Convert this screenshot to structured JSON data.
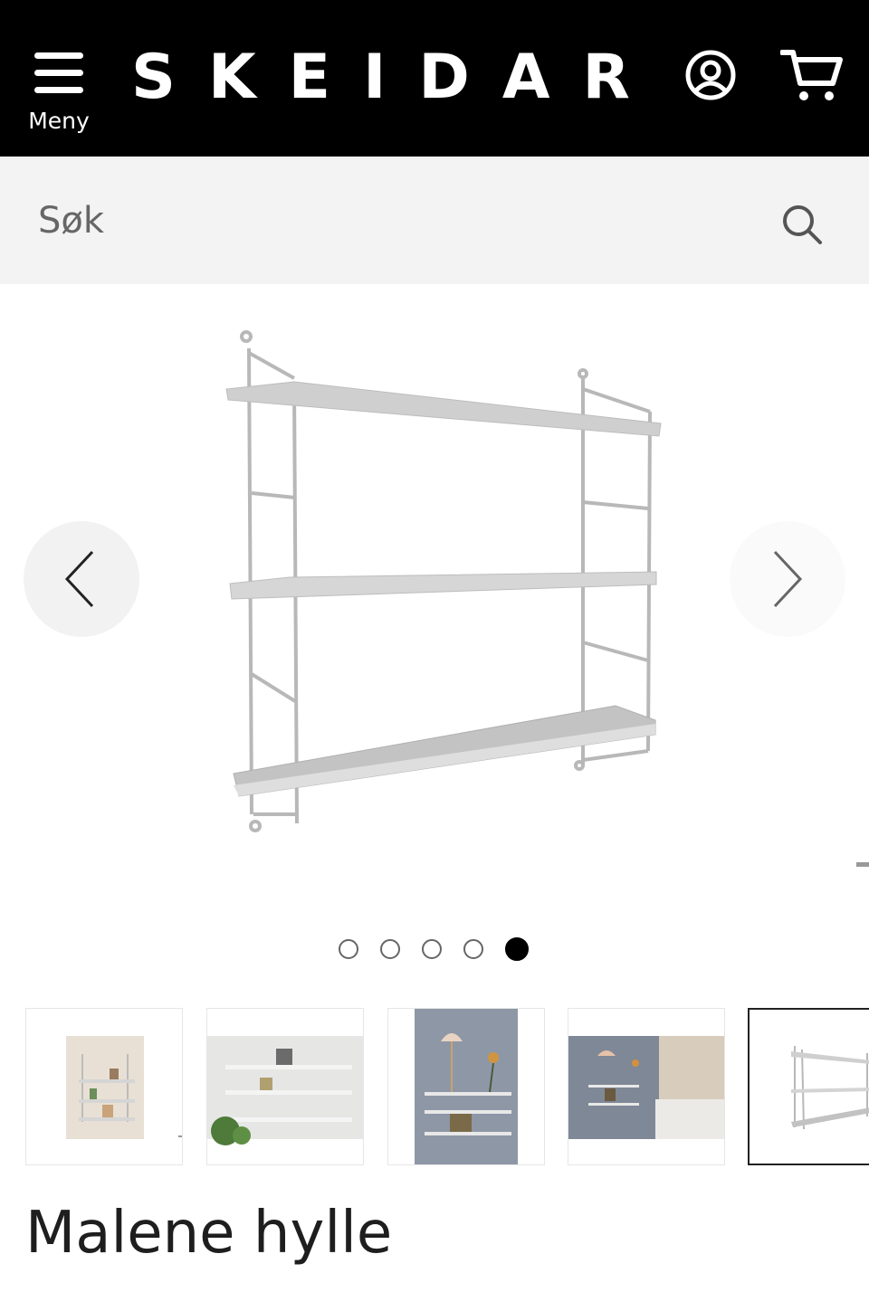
{
  "header": {
    "menu_label": "Meny",
    "logo_text": "SKEIDAR",
    "account_icon": "account-icon",
    "cart_icon": "cart-icon",
    "background": "#000000"
  },
  "search": {
    "placeholder": "Søk",
    "icon": "search-icon"
  },
  "gallery": {
    "image_count": 5,
    "active_index": 5,
    "prev_icon": "chevron-left-icon",
    "next_icon": "chevron-right-icon",
    "thumbnails": [
      {
        "name": "thumbnail-1"
      },
      {
        "name": "thumbnail-2"
      },
      {
        "name": "thumbnail-3"
      },
      {
        "name": "thumbnail-4"
      },
      {
        "name": "thumbnail-5"
      }
    ]
  },
  "product": {
    "title": "Malene hylle"
  }
}
